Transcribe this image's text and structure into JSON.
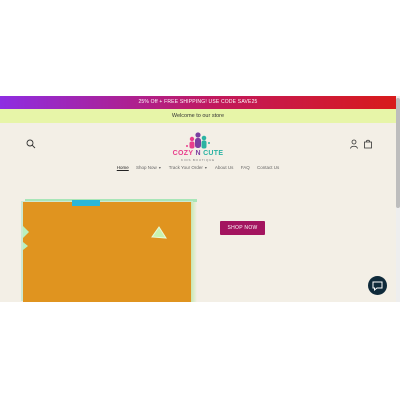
{
  "promo": {
    "text": "25% Off + FREE SHIPPING! USE CODE SAVE25"
  },
  "announcement": {
    "text": "Welcome to our store"
  },
  "logo": {
    "title_part1": "COZY",
    "title_part2": "N",
    "title_part3": "CUTE",
    "subtitle": "KIDS BOUTIQUE"
  },
  "header": {
    "icons": {
      "search": "search-icon",
      "account": "account-icon",
      "cart": "cart-icon"
    }
  },
  "nav": {
    "items": [
      {
        "label": "Home",
        "active": true,
        "dropdown": false
      },
      {
        "label": "Shop Now",
        "active": false,
        "dropdown": true
      },
      {
        "label": "Track Your Order",
        "active": false,
        "dropdown": true
      },
      {
        "label": "About Us",
        "active": false,
        "dropdown": false
      },
      {
        "label": "FAQ",
        "active": false,
        "dropdown": false
      },
      {
        "label": "Contact Us",
        "active": false,
        "dropdown": false
      }
    ]
  },
  "hero": {
    "button_label": "SHOP NOW"
  },
  "chat": {
    "icon": "chat-icon"
  },
  "colors": {
    "promo_gradient_start": "#8e2de2",
    "promo_gradient_end": "#d81b1b",
    "welcome_bg": "#e7f5a8",
    "page_bg": "#f3efe6",
    "button_bg": "#a3145f",
    "logo_pink": "#e83e8c",
    "logo_teal": "#2bb3a3",
    "logo_purple": "#7b3fa0",
    "hero_orange": "#e0941f",
    "chat_bg": "#0f2a3a"
  }
}
